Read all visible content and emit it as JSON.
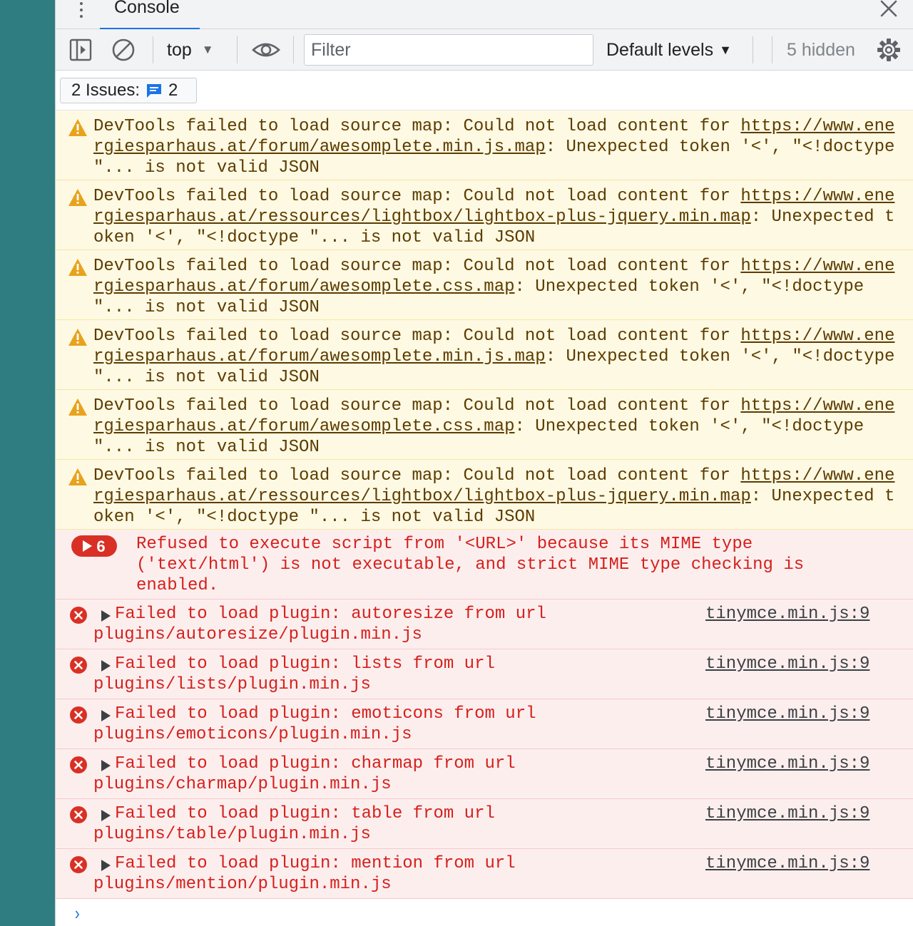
{
  "tabbar": {
    "tab_label": "Console",
    "icons": {
      "menu": "kebab-menu-icon",
      "close": "close-icon"
    }
  },
  "toolbar": {
    "icons": [
      "sidebar-toggle-icon",
      "clear-console-icon",
      "eye-icon",
      "gear-icon"
    ],
    "context": "top",
    "filter_placeholder": "Filter",
    "levels": "Default levels",
    "hidden_count": "5 hidden"
  },
  "issues": {
    "label": "2 Issues:",
    "count": "2"
  },
  "colors": {
    "accent": "#1a73e8",
    "warning_bg": "#fef9e3",
    "warning_text": "#5c3c00",
    "error_bg": "#fdeeee",
    "error_text": "#d4211d",
    "teal_background": "#2f7d80"
  },
  "warnings": [
    {
      "prefix": "DevTools failed to load source map: Could not load content for ",
      "url": "https://www.energiesparhaus.at/forum/awesomplete.min.js.map",
      "suffix": ": Unexpected token '<', \"<!doctype \"... is not valid JSON"
    },
    {
      "prefix": "DevTools failed to load source map: Could not load content for ",
      "url": "https://www.energiesparhaus.at/ressources/lightbox/lightbox-plus-jquery.min.map",
      "suffix": ": Unexpected token '<', \"<!doctype \"... is not valid JSON"
    },
    {
      "prefix": "DevTools failed to load source map: Could not load content for ",
      "url": "https://www.energiesparhaus.at/forum/awesomplete.css.map",
      "suffix": ": Unexpected token '<', \"<!doctype \"... is not valid JSON"
    },
    {
      "prefix": "DevTools failed to load source map: Could not load content for ",
      "url": "https://www.energiesparhaus.at/forum/awesomplete.min.js.map",
      "suffix": ": Unexpected token '<', \"<!doctype \"... is not valid JSON"
    },
    {
      "prefix": "DevTools failed to load source map: Could not load content for ",
      "url": "https://www.energiesparhaus.at/forum/awesomplete.css.map",
      "suffix": ": Unexpected token '<', \"<!doctype \"... is not valid JSON"
    },
    {
      "prefix": "DevTools failed to load source map: Could not load content for ",
      "url": "https://www.energiesparhaus.at/ressources/lightbox/lightbox-plus-jquery.min.map",
      "suffix": ": Unexpected token '<', \"<!doctype \"... is not valid JSON"
    }
  ],
  "error_group": {
    "count": "6",
    "lines": [
      "Refused to execute script from '<URL>' because its MIME type",
      "('text/html') is not executable, and strict MIME type checking is",
      "enabled."
    ]
  },
  "errors": [
    {
      "line1": "Failed to load plugin: autoresize from url",
      "line2": "plugins/autoresize/plugin.min.js",
      "source": "tinymce.min.js:9"
    },
    {
      "line1": "Failed to load plugin: lists from url",
      "line2": "plugins/lists/plugin.min.js",
      "source": "tinymce.min.js:9"
    },
    {
      "line1": "Failed to load plugin: emoticons from url",
      "line2": "plugins/emoticons/plugin.min.js",
      "source": "tinymce.min.js:9"
    },
    {
      "line1": "Failed to load plugin: charmap from url",
      "line2": "plugins/charmap/plugin.min.js",
      "source": "tinymce.min.js:9"
    },
    {
      "line1": "Failed to load plugin: table from url",
      "line2": "plugins/table/plugin.min.js",
      "source": "tinymce.min.js:9"
    },
    {
      "line1": "Failed to load plugin: mention from url",
      "line2": "plugins/mention/plugin.min.js",
      "source": "tinymce.min.js:9"
    }
  ],
  "prompt": {
    "icon": "prompt-chevron-icon",
    "symbol": "›"
  }
}
